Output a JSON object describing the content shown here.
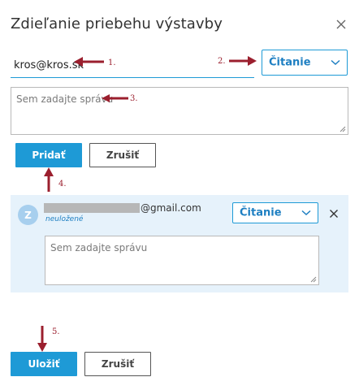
{
  "dialog": {
    "title": "Zdieľanie priebehu výstavby",
    "close_icon": "close-icon"
  },
  "share_form": {
    "email_value": "kros@kros.sk",
    "permission": "Čitanie",
    "message_placeholder": "Sem zadajte správu",
    "add_label": "Pridať",
    "cancel_label": "Zrušiť"
  },
  "shared_user": {
    "avatar_letter": "Z",
    "email_suffix": "@gmail.com",
    "status": "neuložené",
    "permission": "Čitanie",
    "message_placeholder": "Sem zadajte správu"
  },
  "footer": {
    "save_label": "Uložiť",
    "cancel_label": "Zrušiť"
  },
  "annotations": {
    "a1": "1.",
    "a2": "2.",
    "a3": "3.",
    "a4": "4.",
    "a5": "5."
  },
  "colors": {
    "accent": "#1e9ad6",
    "annotation": "#9b1f2e",
    "panel": "#e6f2fb"
  }
}
